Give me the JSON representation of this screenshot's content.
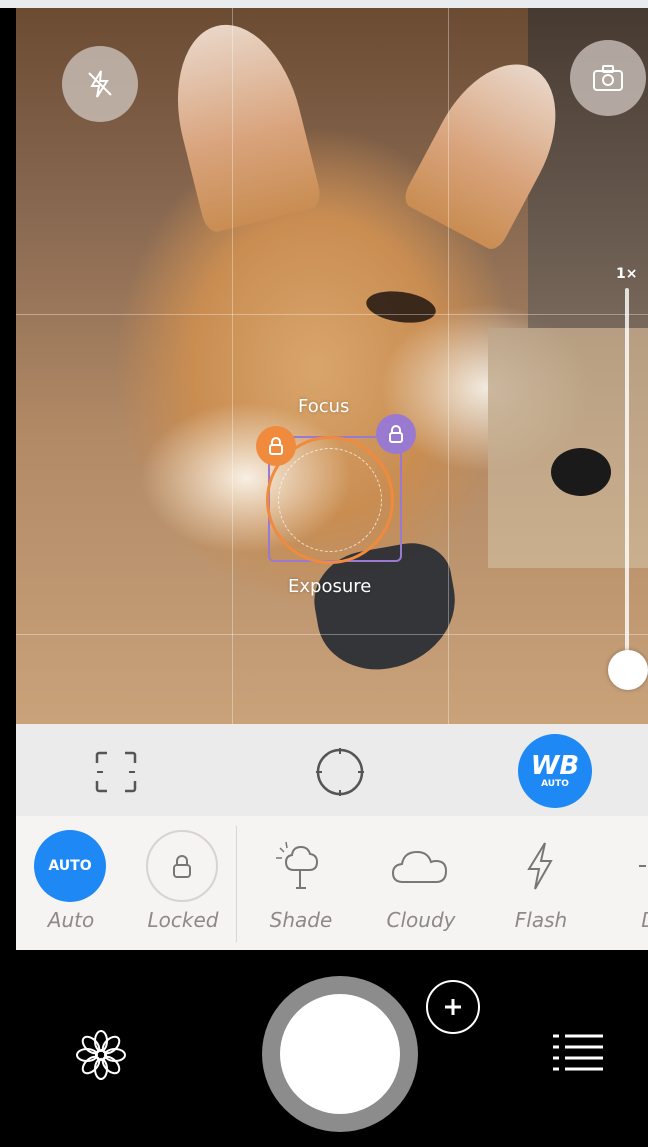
{
  "viewfinder": {
    "zoom_label": "1×",
    "zoom_level": 1,
    "focus_label": "Focus",
    "exposure_label": "Exposure"
  },
  "top_controls": {
    "flash_icon": "flash-off-icon",
    "camera_icon": "camera-switch-icon"
  },
  "mode_bar": {
    "focus_icon": "focus-frame-icon",
    "exposure_icon": "exposure-circle-icon",
    "wb_label": "WB",
    "wb_sublabel": "AUTO"
  },
  "white_balance": {
    "presets": [
      {
        "label": "Auto",
        "icon_text": "AUTO",
        "selected": true
      },
      {
        "label": "Locked",
        "icon": "lock-icon"
      },
      {
        "label": "Shade",
        "icon": "tree-shade-icon"
      },
      {
        "label": "Cloudy",
        "icon": "cloud-icon"
      },
      {
        "label": "Flash",
        "icon": "flash-bolt-icon"
      },
      {
        "label": "Day",
        "icon": "sun-icon"
      }
    ]
  },
  "bottom_bar": {
    "settings_icon": "settings-flower-icon",
    "plus_icon": "plus-icon",
    "menu_icon": "menu-list-icon"
  },
  "colors": {
    "accent_blue": "#1e88f4",
    "focus_orange": "#f08a3c",
    "exposure_purple": "#9a7ad0"
  }
}
